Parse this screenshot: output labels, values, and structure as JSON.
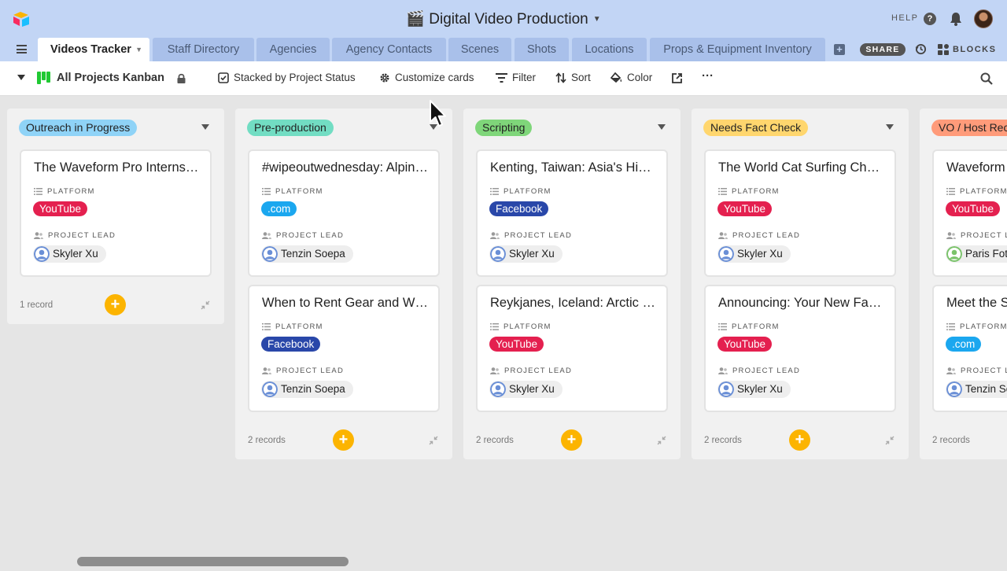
{
  "app": {
    "base_title": "🎬 Digital Video Production",
    "help_label": "HELP"
  },
  "tabs": [
    {
      "label": "Videos Tracker",
      "active": true
    },
    {
      "label": "Staff Directory"
    },
    {
      "label": "Agencies"
    },
    {
      "label": "Agency Contacts"
    },
    {
      "label": "Scenes"
    },
    {
      "label": "Shots"
    },
    {
      "label": "Locations"
    },
    {
      "label": "Props & Equipment Inventory"
    }
  ],
  "tabbar": {
    "share_label": "SHARE",
    "blocks_label": "BLOCKS"
  },
  "toolbar": {
    "view_name": "All Projects Kanban",
    "stacked_label": "Stacked by Project Status",
    "customize_label": "Customize cards",
    "filter_label": "Filter",
    "sort_label": "Sort",
    "color_label": "Color",
    "more_label": "···"
  },
  "field_labels": {
    "platform": "PLATFORM",
    "project_lead": "PROJECT LEAD"
  },
  "colors": {
    "youtube": "#e4204f",
    "dotcom": "#1ba7ef",
    "facebook": "#2947a9",
    "accent_add": "#fcb400"
  },
  "columns": [
    {
      "status": "Outreach in Progress",
      "status_color": "#8fd3f7",
      "record_count": "1 record",
      "cards": [
        {
          "title": "The Waveform Pro Internship",
          "platform": "YouTube",
          "platform_color": "#e4204f",
          "lead": "Skyler Xu",
          "lead_color": "#6a8fd6"
        }
      ]
    },
    {
      "status": "Pre-production",
      "status_color": "#72ddc3",
      "record_count": "2 records",
      "cards": [
        {
          "title": "#wipeoutwednesday: Alpine Fails",
          "platform": ".com",
          "platform_color": "#1ba7ef",
          "lead": "Tenzin Soepa",
          "lead_color": "#6a8fd6"
        },
        {
          "title": "When to Rent Gear and When to Buy",
          "platform": "Facebook",
          "platform_color": "#2947a9",
          "lead": "Tenzin Soepa",
          "lead_color": "#6a8fd6"
        }
      ]
    },
    {
      "status": "Scripting",
      "status_color": "#7fd67a",
      "record_count": "2 records",
      "cards": [
        {
          "title": "Kenting, Taiwan: Asia's Hidden Surf",
          "platform": "Facebook",
          "platform_color": "#2947a9",
          "lead": "Skyler Xu",
          "lead_color": "#6a8fd6"
        },
        {
          "title": "Reykjanes, Iceland: Arctic Surfing",
          "platform": "YouTube",
          "platform_color": "#e4204f",
          "lead": "Skyler Xu",
          "lead_color": "#6a8fd6"
        }
      ]
    },
    {
      "status": "Needs Fact Check",
      "status_color": "#ffd66e",
      "record_count": "2 records",
      "cards": [
        {
          "title": "The World Cat Surfing Championship",
          "platform": "YouTube",
          "platform_color": "#e4204f",
          "lead": "Skyler Xu",
          "lead_color": "#6a8fd6"
        },
        {
          "title": "Announcing: Your New Favorite Board",
          "platform": "YouTube",
          "platform_color": "#e4204f",
          "lead": "Skyler Xu",
          "lead_color": "#6a8fd6"
        }
      ]
    },
    {
      "status": "VO / Host Recording",
      "status_color": "#ff9b7a",
      "record_count": "2 records",
      "cards": [
        {
          "title": "Waveform",
          "platform": "YouTube",
          "platform_color": "#e4204f",
          "lead": "Paris Fotiou",
          "lead_color": "#7ac36a"
        },
        {
          "title": "Meet the Shapers",
          "platform": ".com",
          "platform_color": "#1ba7ef",
          "lead": "Tenzin Soepa",
          "lead_color": "#6a8fd6"
        }
      ]
    }
  ]
}
